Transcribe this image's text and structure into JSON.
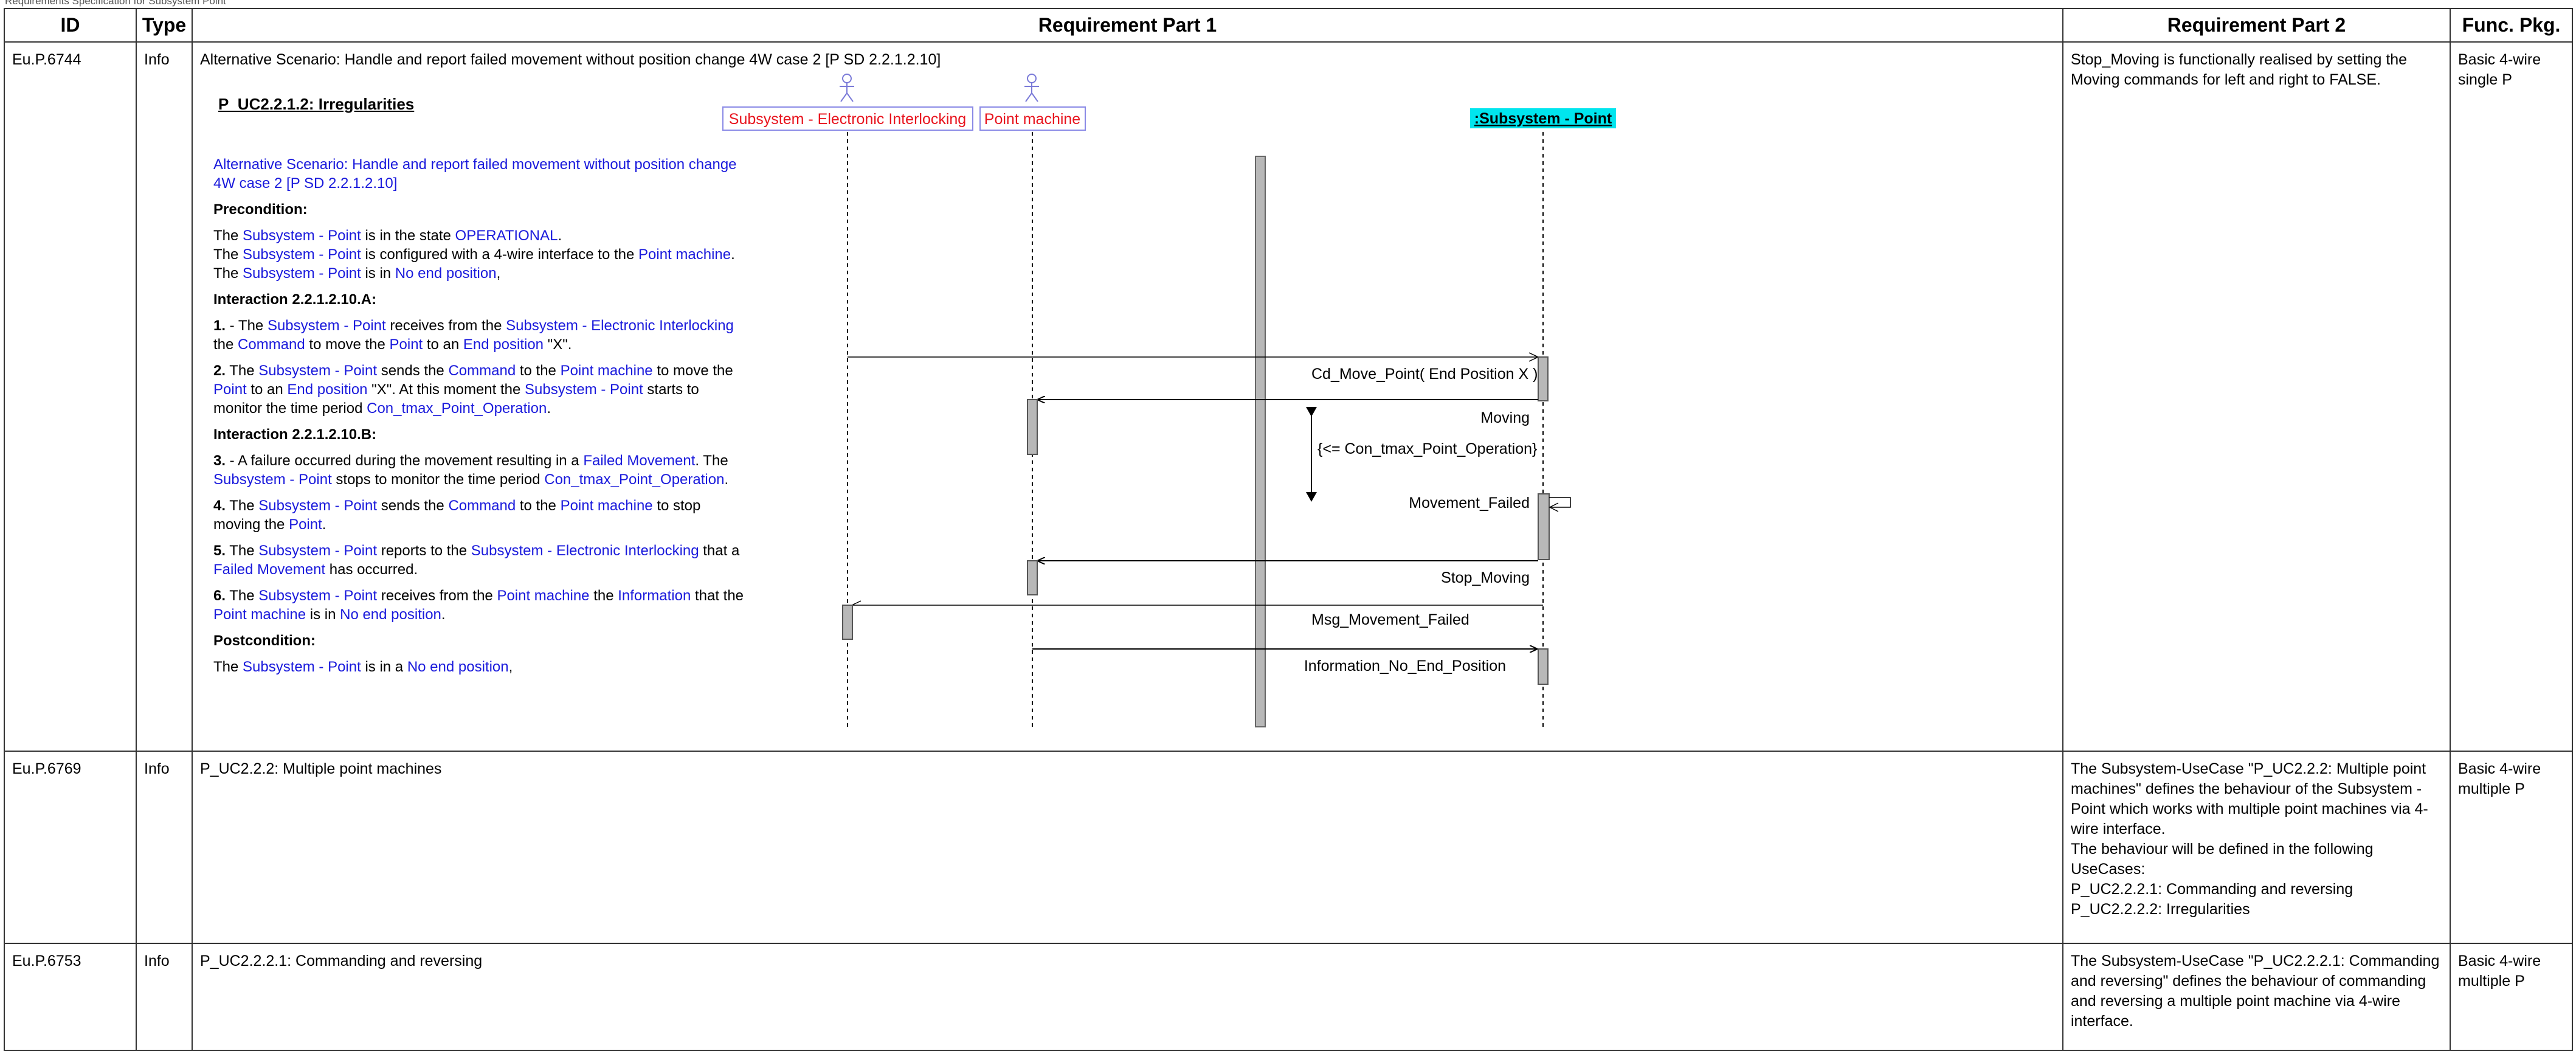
{
  "doc": {
    "title": "Requirements Specification for Subsystem Point"
  },
  "columns": {
    "id": "ID",
    "type": "Type",
    "part1": "Requirement Part 1",
    "part2": "Requirement Part 2",
    "func": "Func. Pkg."
  },
  "rows": [
    {
      "id": "Eu.P.6744",
      "type": "Info",
      "title": "Alternative Scenario: Handle and report failed movement without position change 4W case 2 [P SD 2.2.1.2.10]",
      "part2": "Stop_Moving is functionally realised by setting the Moving commands for left and right to FALSE.",
      "func": "Basic 4-wire single P"
    },
    {
      "id": "Eu.P.6769",
      "type": "Info",
      "title": "P_UC2.2.2: Multiple point machines",
      "part2_lines": [
        "The Subsystem-UseCase \"P_UC2.2.2: Multiple point machines\" defines the behaviour of the Subsystem - Point which works with multiple point machines via 4-wire interface.",
        "The behaviour will be defined in the following UseCases:",
        "P_UC2.2.2.1: Commanding and reversing",
        "P_UC2.2.2.2: Irregularities"
      ],
      "func": "Basic 4-wire multiple P"
    },
    {
      "id": "Eu.P.6753",
      "type": "Info",
      "title": "P_UC2.2.2.1: Commanding and reversing",
      "part2": "The Subsystem-UseCase \"P_UC2.2.2.1: Commanding and reversing\" defines the behaviour of commanding and reversing a multiple point machine via 4-wire interface.",
      "func": "Basic 4-wire multiple P"
    }
  ],
  "diagram": {
    "uc_title": "P_UC2.2.1.2: Irregularities",
    "actors": {
      "ixl": "Subsystem - Electronic Interlocking",
      "pm": "Point machine",
      "point": ":Subsystem - Point"
    },
    "messages": {
      "m1": "Cd_Move_Point( End Position X )",
      "m2": "Moving",
      "m3": "{<= Con_tmax_Point_Operation}",
      "m4": "Movement_Failed",
      "m5": "Stop_Moving",
      "m6": "Msg_Movement_Failed",
      "m7": "Information_No_End_Position"
    },
    "colors": {
      "actor_red": "#e8141e",
      "actor_box_blue": "#6a6ad8",
      "point_highlight": "#00e5ee",
      "term_blue": "#1a1adc",
      "activation_grey": "#b8b8b8"
    },
    "text": {
      "scenario_title": "Alternative Scenario: Handle and report failed movement without position change 4W case 2 [P SD 2.2.1.2.10]",
      "precondition_h": "Precondition:",
      "pre1": [
        "The ",
        "Subsystem - Point",
        " is in the state ",
        "OPERATIONAL",
        "."
      ],
      "pre2": [
        "The ",
        "Subsystem - Point",
        " is configured with a 4-wire interface to the ",
        "Point machine",
        "."
      ],
      "pre3": [
        "The ",
        "Subsystem - Point",
        " is in ",
        "No end position",
        ","
      ],
      "interA_h": "Interaction 2.2.1.2.10.A:",
      "s1": [
        "1.",
        " - The ",
        "Subsystem - Point",
        " receives from the ",
        "Subsystem - Electronic Interlocking",
        " the ",
        "Command",
        " to move the ",
        "Point",
        " to an ",
        "End position",
        " \"X\"."
      ],
      "s2": [
        "2.",
        " The ",
        "Subsystem - Point",
        " sends the ",
        "Command",
        " to the ",
        "Point machine",
        " to move the ",
        "Point",
        " to an ",
        "End position",
        " \"X\". At this moment the ",
        "Subsystem - Point",
        " starts to monitor the time period ",
        "Con_tmax_Point_Operation",
        "."
      ],
      "interB_h": "Interaction 2.2.1.2.10.B:",
      "s3": [
        "3.",
        " - A failure occurred during the movement resulting in a ",
        "Failed Movement",
        ". The ",
        "Subsystem - Point",
        " stops to monitor the time period ",
        "Con_tmax_Point_Operation",
        "."
      ],
      "s4": [
        "4.",
        " The ",
        "Subsystem - Point",
        " sends the ",
        "Command",
        " to the ",
        "Point machine",
        " to stop moving the ",
        "Point",
        "."
      ],
      "s5": [
        "5.",
        " The ",
        "Subsystem - Point",
        " reports to the ",
        "Subsystem - Electronic Interlocking",
        " that a ",
        "Failed Movement",
        " has occurred."
      ],
      "s6": [
        "6.",
        " The ",
        "Subsystem - Point",
        " receives from the ",
        "Point machine",
        " the ",
        "Information",
        " that the ",
        "Point machine",
        " is in ",
        "No end position",
        "."
      ],
      "post_h": "Postcondition:",
      "post1": [
        "The ",
        "Subsystem - Point",
        " is in a ",
        "No end position",
        ","
      ]
    }
  }
}
